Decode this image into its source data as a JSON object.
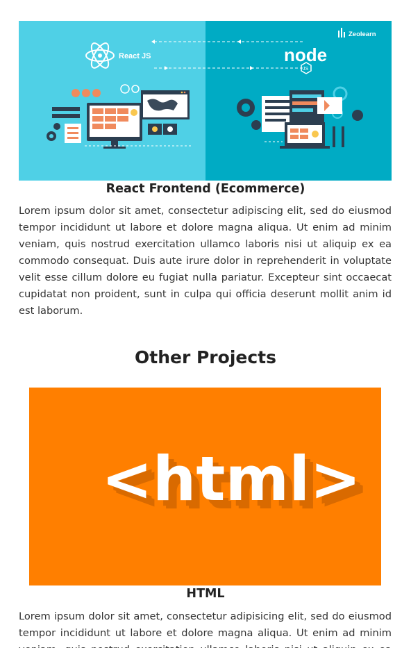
{
  "project_one": {
    "image_brand": "Zeolearn",
    "image_react_label": "React JS",
    "image_node_label": "node",
    "image_node_sub": "JS",
    "title": "React Frontend (Ecommerce)",
    "description": "Lorem ipsum dolor sit amet, consectetur adipiscing elit, sed do eiusmod tempor incididunt ut labore et dolore magna aliqua. Ut enim ad minim veniam, quis nostrud exercitation ullamco laboris nisi ut aliquip ex ea commodo consequat. Duis aute irure dolor in reprehenderit in voluptate velit esse cillum dolore eu fugiat nulla pariatur. Excepteur sint occaecat cupidatat non proident, sunt in culpa qui officia deserunt mollit anim id est laborum."
  },
  "other_projects": {
    "heading": "Other Projects",
    "items": [
      {
        "image_text": "<html>",
        "title": "HTML",
        "description": "Lorem ipsum dolor sit amet, consectetur adipisicing elit, sed do eiusmod tempor incididunt ut labore et dolore magna aliqua. Ut enim ad minim veniam, quis nostrud exercitation ullamco laboris nisi ut aliquip ex ea commodo consequat."
      }
    ]
  },
  "colors": {
    "hero_left": "#4fd0e6",
    "hero_right": "#00abc4",
    "html_orange": "#ff7f00",
    "html_shadow": "#d96a00"
  },
  "icons": [
    "react-logo-icon",
    "nodejs-logo-icon",
    "zeolearn-logo-icon",
    "gear-icon",
    "laptop-icon",
    "monitor-icon"
  ]
}
